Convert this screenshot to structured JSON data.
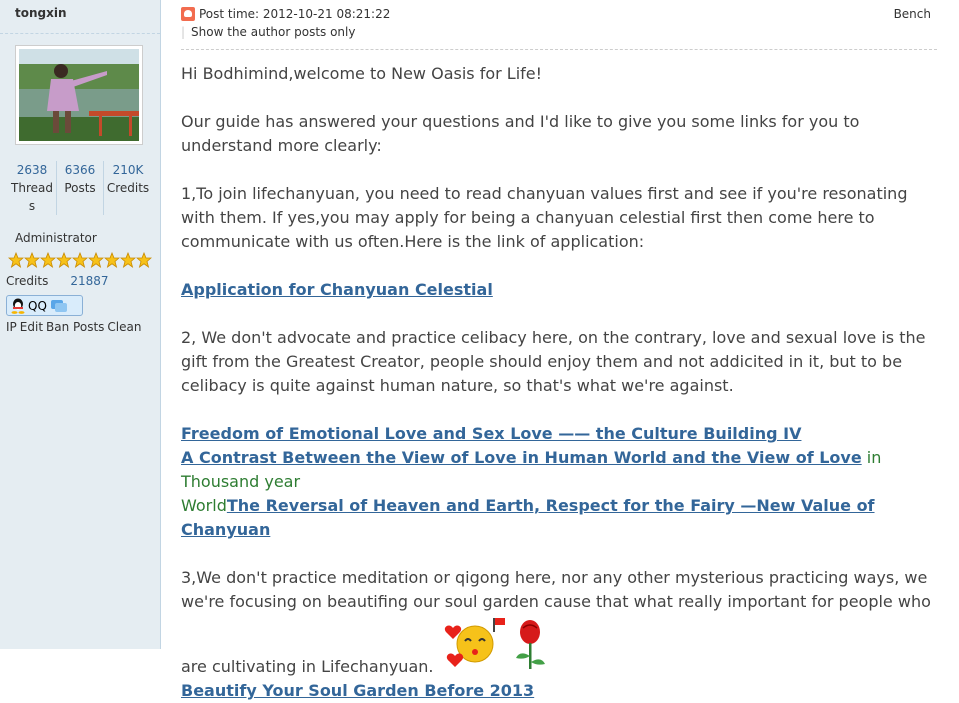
{
  "sidebar": {
    "username": "tongxin",
    "stats": [
      {
        "value": "2638",
        "label": "Thread\ns"
      },
      {
        "value": "6366",
        "label": "Posts"
      },
      {
        "value": "210K",
        "label": "Credits"
      }
    ],
    "role": "Administrator",
    "star_count": 9,
    "credits_label": "Credits",
    "credits_value": "21887",
    "qq_label": "QQ",
    "admin_links": [
      "IP",
      "Edit",
      "Ban Posts",
      "Clean"
    ]
  },
  "post": {
    "post_time": "Post time: 2012-10-21 08:21:22",
    "author_only": "Show the author posts only",
    "bench": "Bench",
    "greeting": "Hi Bodhimind,welcome to New Oasis for Life!",
    "para1": "Our guide has answered your questions and I'd like to give you some links for you to understand more clearly:",
    "para2": "1,To join lifechanyuan, you need to read chanyuan values first and see if you're resonating with them. If yes,you may apply for being a chanyuan celestial first then come here to communicate with us often.Here is the link of application:",
    "link_application": "Application for Chanyuan Celestial",
    "para3": "2, We don't advocate and practice celibacy here, on the contrary, love and sexual love is the gift from the Greatest Creator, people should enjoy them and not addicited in it, but to be celibacy is quite against human nature, so that's what we're against.",
    "link_freedom": "Freedom of Emotional Love and Sex Love —— the Culture Building IV",
    "link_contrast": "A Contrast Between the View of Love in Human World and the View of Love",
    "green_text_1": " in Thousand year",
    "green_text_2": "World",
    "link_reversal": "The Reversal of Heaven and Earth, Respect for the Fairy —New Value of Chanyuan",
    "para4": "3,We don't practice meditation or qigong here, nor any other mysterious practicing ways, we we're focusing on beautifing our soul garden cause that what really important for people who",
    "para4_end": "are cultivating in Lifechanyuan.",
    "link_soul": "Beautify Your Soul Garden Before 2013"
  },
  "colors": {
    "link": "#336699",
    "green": "#2e7d32",
    "sidebar_bg": "#e5edf2"
  }
}
